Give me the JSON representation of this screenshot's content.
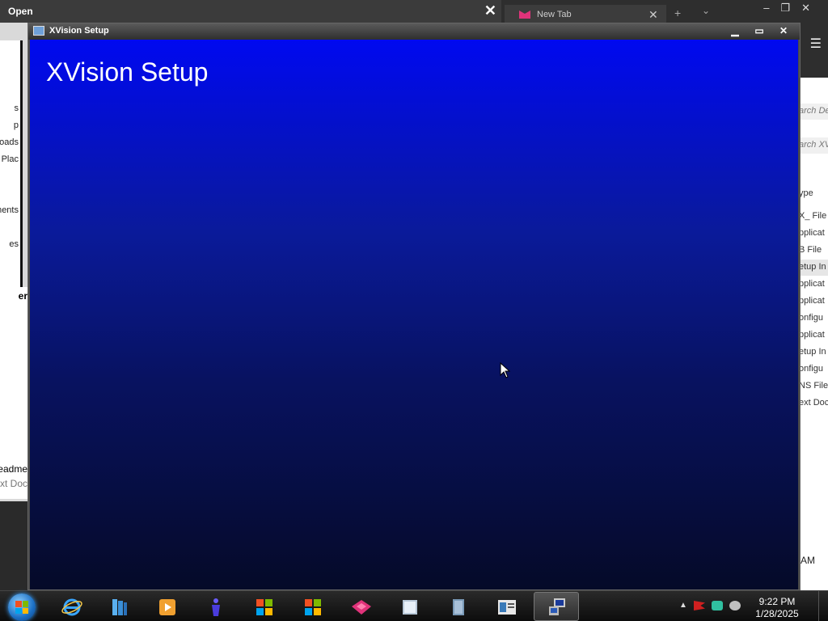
{
  "open_dialog": {
    "title": "Open",
    "nav_items": [
      "s",
      "p",
      "oads",
      "Plac",
      "ments",
      "es"
    ],
    "header": "er",
    "file_name": "eadme",
    "file_type": "ext Doc"
  },
  "browser": {
    "tab_title": "New Tab",
    "search_placeholder_1": "arch De",
    "search_placeholder_2": "arch XV",
    "column_header": "ype",
    "types": [
      "X_ File",
      "pplicat",
      "B File",
      "etup In",
      "pplicat",
      "pplicat",
      "onfigu",
      "pplicat",
      "etup In",
      "onfigu",
      "NS File",
      "ext Doc"
    ],
    "selected_index": 3,
    "time_fragment": "AM"
  },
  "xvision": {
    "window_title": "XVision Setup",
    "heading": "XVision Setup",
    "gradient": {
      "top": "#0009f0",
      "bottom": "#050a28"
    }
  },
  "taskbar": {
    "buttons": [
      {
        "name": "internet-explorer",
        "icon": "ie-icon"
      },
      {
        "name": "library",
        "icon": "library-icon"
      },
      {
        "name": "media-player",
        "icon": "media-player-icon"
      },
      {
        "name": "app-purple",
        "icon": "figure-icon"
      },
      {
        "name": "windows-app-1",
        "icon": "windows-flag-icon"
      },
      {
        "name": "windows-app-2",
        "icon": "windows-flag-icon"
      },
      {
        "name": "browser",
        "icon": "browser-icon"
      },
      {
        "name": "explorer",
        "icon": "folder-icon"
      },
      {
        "name": "document",
        "icon": "document-icon"
      },
      {
        "name": "setup",
        "icon": "setup-icon"
      },
      {
        "name": "xvision-setup",
        "icon": "computer-icon",
        "active": true
      }
    ],
    "time": "9:22 PM",
    "date": "1/28/2025"
  }
}
